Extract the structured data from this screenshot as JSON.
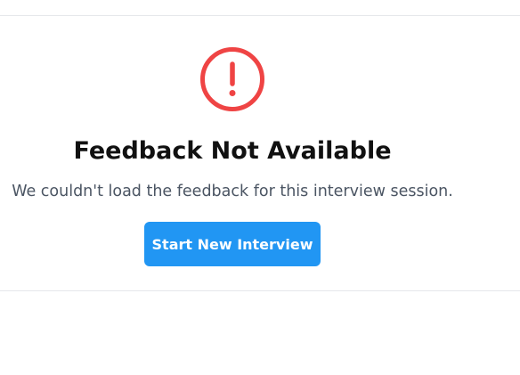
{
  "feedback_error": {
    "icon": "alert-circle-icon",
    "icon_color": "#ef4444",
    "title": "Feedback Not Available",
    "message": "We couldn't load the feedback for this interview session.",
    "action_label": "Start New Interview",
    "action_color": "#2196f3"
  }
}
